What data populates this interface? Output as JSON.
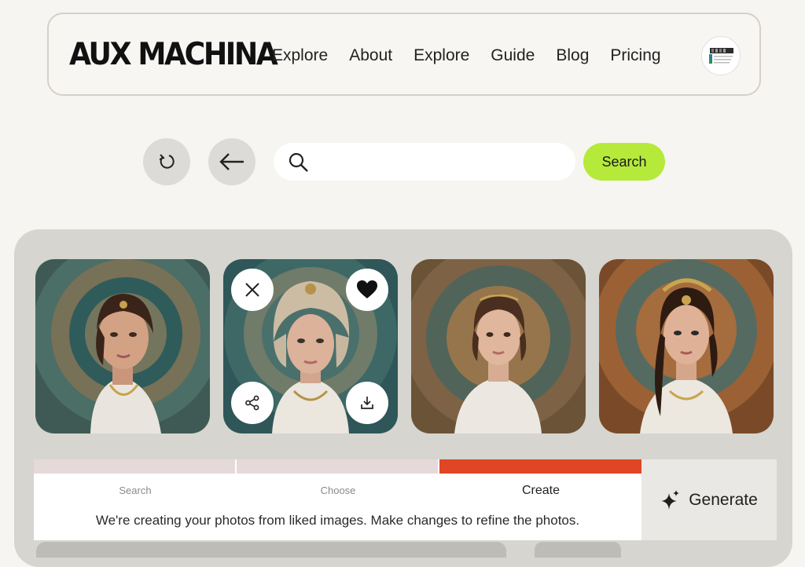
{
  "header": {
    "logo": "AUX MACHINA",
    "nav": [
      "Explore",
      "About",
      "Explore",
      "Guide",
      "Blog",
      "Pricing"
    ]
  },
  "toolbar": {
    "search_placeholder": "",
    "search_label": "Search"
  },
  "steps": {
    "items": [
      {
        "label": "Search",
        "active": false
      },
      {
        "label": "Choose",
        "active": false
      },
      {
        "label": "Create",
        "active": true
      }
    ],
    "message": "We're creating your photos from liked images. Make changes to refine the photos.",
    "generate_label": "Generate"
  },
  "colors": {
    "accent_green": "#b5ea3a",
    "step_active": "#e04526",
    "step_inactive": "#e5d9d9",
    "panel": "#d6d5cf"
  },
  "icons": [
    "refresh-icon",
    "back-arrow-icon",
    "search-icon",
    "close-icon",
    "heart-icon",
    "share-icon",
    "download-icon",
    "sparkle-icon"
  ]
}
